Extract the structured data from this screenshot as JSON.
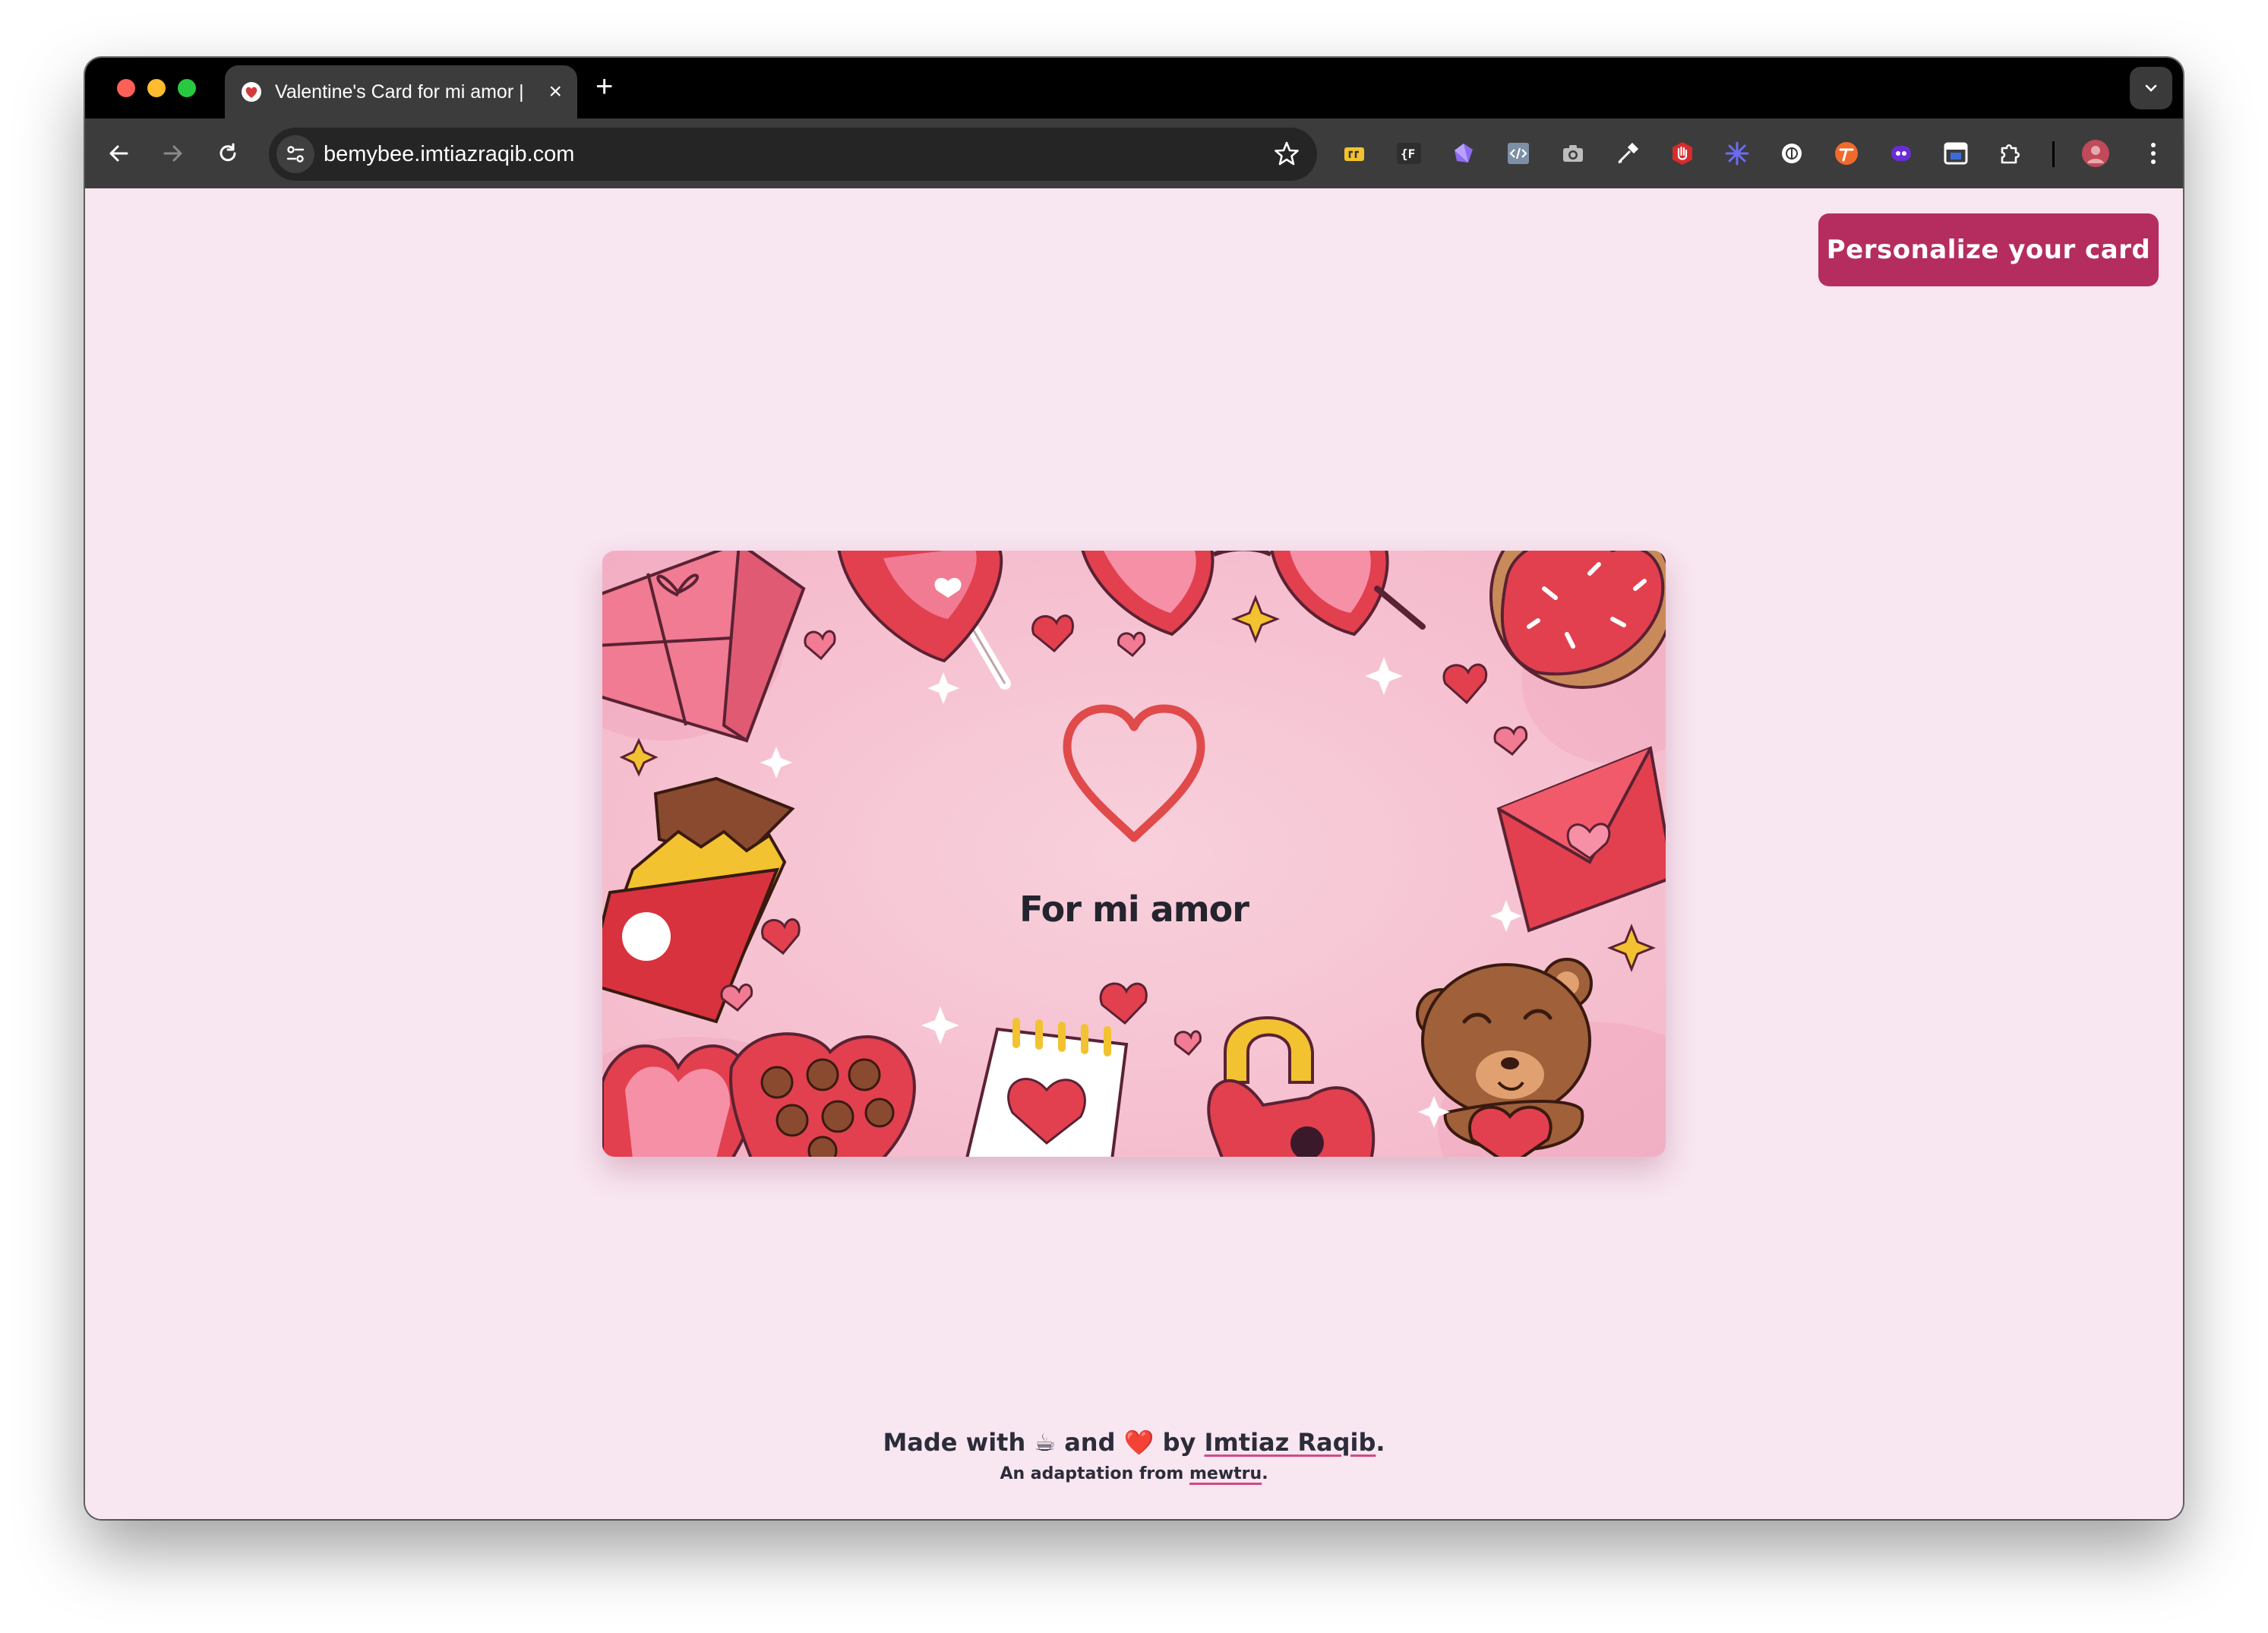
{
  "browser": {
    "tab": {
      "title": "Valentine's Card for mi amor |",
      "favicon": "rose-favicon-icon"
    },
    "new_tab_label": "+",
    "url": "bemybee.imtiazraqib.com",
    "extension_icons": [
      "folder-extension-icon",
      "json-formatter-icon",
      "gem-extension-icon",
      "code-viewer-icon",
      "camera-icon",
      "eyedropper-icon",
      "hand-stop-icon",
      "snowflake-icon",
      "globe-icon",
      "text-tool-icon",
      "purple-extension-icon",
      "screen-capture-icon",
      "puzzle-icon"
    ]
  },
  "page": {
    "personalize_label": "Personalize your card",
    "card": {
      "title": "For mi amor"
    },
    "footer": {
      "made_with": "Made with",
      "coffee": "☕",
      "and": "and",
      "heart": "❤️",
      "by": "by",
      "author": "Imtiaz Raqib",
      "period": ".",
      "adaptation": "An adaptation from",
      "source": "mewtru",
      "period2": "."
    }
  },
  "colors": {
    "page_bg": "#f8e6f1",
    "button": "#b52d5f",
    "card_bg": "#f8cbd8",
    "heart_outline": "#e04a4a"
  }
}
